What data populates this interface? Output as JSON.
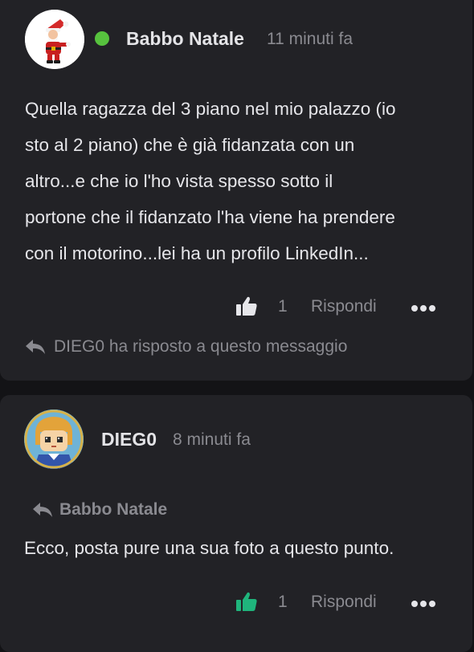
{
  "posts": [
    {
      "author": "Babbo Natale",
      "time": "11 minuti fa",
      "online": true,
      "avatar_icon": "santa-avatar",
      "body_lines": [
        "Quella ragazza del 3 piano nel mio palazzo (io",
        "sto al 2 piano) che è già fidanzata con un",
        "altro...e che io l'ho vista spesso sotto il",
        "portone che il fidanzato l'ha viene ha prendere",
        "con il motorino...lei ha un profilo LinkedIn..."
      ],
      "likes": "1",
      "reply_label": "Rispondi",
      "replied_note": "DIEG0 ha risposto a questo messaggio"
    },
    {
      "author": "DIEG0",
      "time": "8 minuti fa",
      "avatar_icon": "pixel-character-avatar",
      "quote_ref": "Babbo Natale",
      "body_lines": [
        "Ecco, posta pure una sua foto a questo punto."
      ],
      "likes": "1",
      "liked": true,
      "reply_label": "Rispondi"
    }
  ],
  "colors": {
    "background": "#131316",
    "card": "#222226",
    "online": "#57c23e",
    "liked": "#1fb57c",
    "muted": "#8a8a90"
  }
}
